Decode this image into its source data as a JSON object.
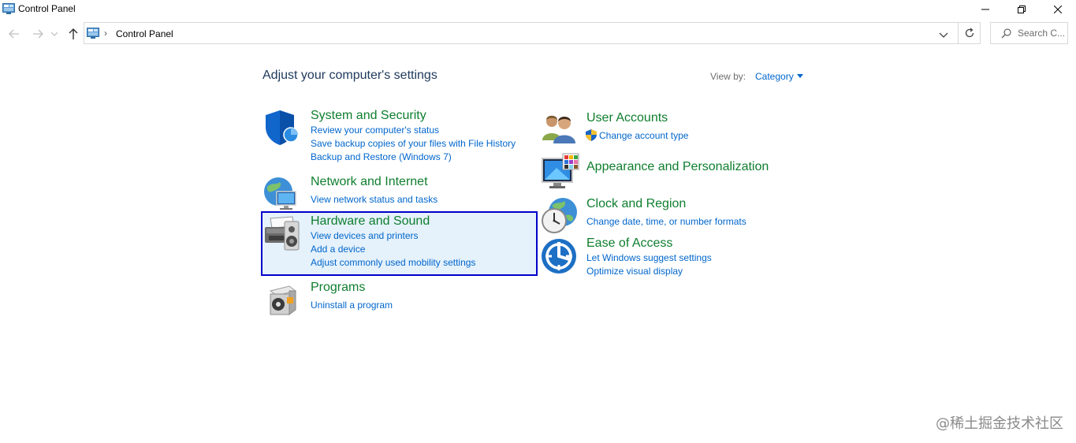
{
  "window": {
    "title": "Control Panel"
  },
  "address": {
    "crumb": "Control Panel",
    "separator": "›"
  },
  "search": {
    "placeholder": "Search C..."
  },
  "header": {
    "heading": "Adjust your computer's settings",
    "view_by_label": "View by:",
    "view_by_value": "Category"
  },
  "categories_left": [
    {
      "title": "System and Security",
      "icon": "shield-icon",
      "links": [
        "Review your computer's status",
        "Save backup copies of your files with File History",
        "Backup and Restore (Windows 7)"
      ]
    },
    {
      "title": "Network and Internet",
      "icon": "globe-network-icon",
      "links": [
        "View network status and tasks"
      ]
    },
    {
      "title": "Hardware and Sound",
      "icon": "printer-speaker-icon",
      "selected": true,
      "links": [
        "View devices and printers",
        "Add a device",
        "Adjust commonly used mobility settings"
      ]
    },
    {
      "title": "Programs",
      "icon": "program-disc-icon",
      "links": [
        "Uninstall a program"
      ]
    }
  ],
  "categories_right": [
    {
      "title": "User Accounts",
      "icon": "users-icon",
      "links": [
        "Change account type"
      ]
    },
    {
      "title": "Appearance and Personalization",
      "icon": "monitor-palette-icon",
      "links": []
    },
    {
      "title": "Clock and Region",
      "icon": "clock-globe-icon",
      "links": [
        "Change date, time, or number formats"
      ]
    },
    {
      "title": "Ease of Access",
      "icon": "ease-of-access-icon",
      "links": [
        "Let Windows suggest settings",
        "Optimize visual display"
      ]
    }
  ],
  "colors": {
    "title_green": "#0e7e2e",
    "link_blue": "#0066cc",
    "heading": "#1e395b",
    "selection_border": "#0000c8"
  },
  "watermark": "@稀土掘金技术社区"
}
